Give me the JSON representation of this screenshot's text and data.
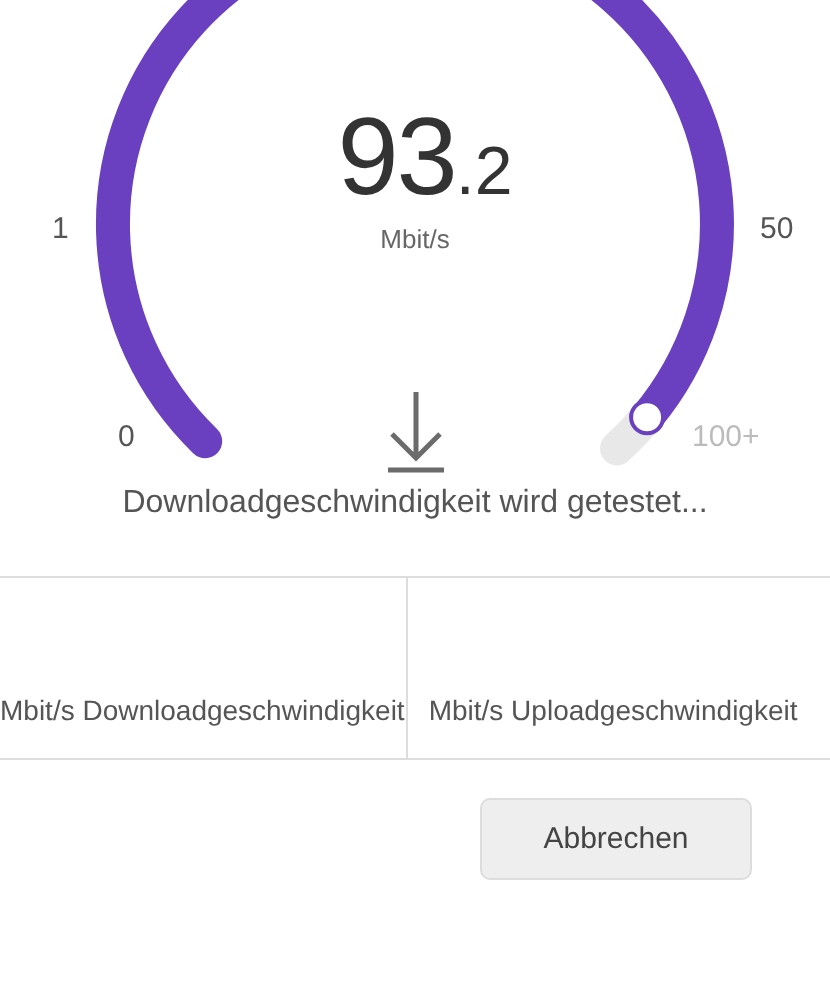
{
  "gauge": {
    "value": "93",
    "decimal": ".2",
    "unit": "Mbit/s",
    "scale_labels": [
      "0",
      "1",
      "50",
      "100+"
    ]
  },
  "status": "Downloadgeschwindigkeit wird getestet...",
  "results": [
    {
      "label": "Mbit/s Downloadgeschwindigkeit"
    },
    {
      "label": "Mbit/s Uploadgeschwindigkeit"
    }
  ],
  "cancel_button": "Abbrechen"
}
